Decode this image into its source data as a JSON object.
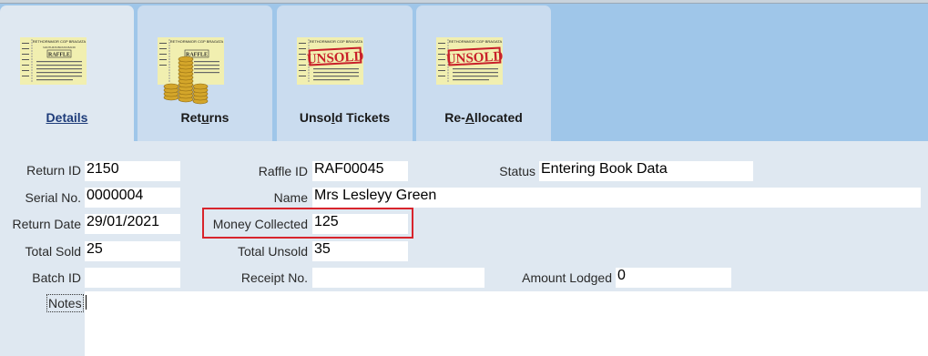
{
  "tabs": [
    {
      "label": "Details",
      "accel_index": 0,
      "image": "ticket-icon",
      "active": true
    },
    {
      "label": "Returns",
      "accel_index": 3,
      "image": "ticket-coins-icon",
      "active": false
    },
    {
      "label": "Unsold Tickets",
      "accel_index": 4,
      "image": "ticket-unsold-icon",
      "active": false
    },
    {
      "label": "Re-Allocated",
      "accel_index": 3,
      "image": "ticket-unsold-icon",
      "active": false
    }
  ],
  "ticket": {
    "header": "RETHORNMOR CGP BRAGATA",
    "sub": "NANTHINS BRASS BAND",
    "title": "RAFFLE",
    "stamp": "UNSOLD"
  },
  "form": {
    "return_id": {
      "label": "Return ID",
      "value": "2150"
    },
    "serial_no": {
      "label": "Serial No.",
      "value": "0000004"
    },
    "return_date": {
      "label": "Return Date",
      "value": "29/01/2021"
    },
    "total_sold": {
      "label": "Total Sold",
      "value": "25"
    },
    "batch_id": {
      "label": "Batch ID",
      "value": ""
    },
    "raffle_id": {
      "label": "Raffle ID",
      "value": "RAF00045"
    },
    "name": {
      "label": "Name",
      "value": "Mrs Lesleyy Green"
    },
    "money_collected": {
      "label": "Money Collected",
      "value": "125"
    },
    "total_unsold": {
      "label": "Total Unsold",
      "value": "35"
    },
    "receipt_no": {
      "label": "Receipt No.",
      "value": ""
    },
    "status": {
      "label": "Status",
      "value": "Entering Book Data"
    },
    "amount_lodged": {
      "label": "Amount Lodged",
      "value": "0"
    },
    "notes": {
      "label": "Notes",
      "value": ""
    }
  },
  "colors": {
    "highlight": "#d8242c",
    "tabbar": "#9fc6e9",
    "form_bg": "#dfe8f1"
  }
}
